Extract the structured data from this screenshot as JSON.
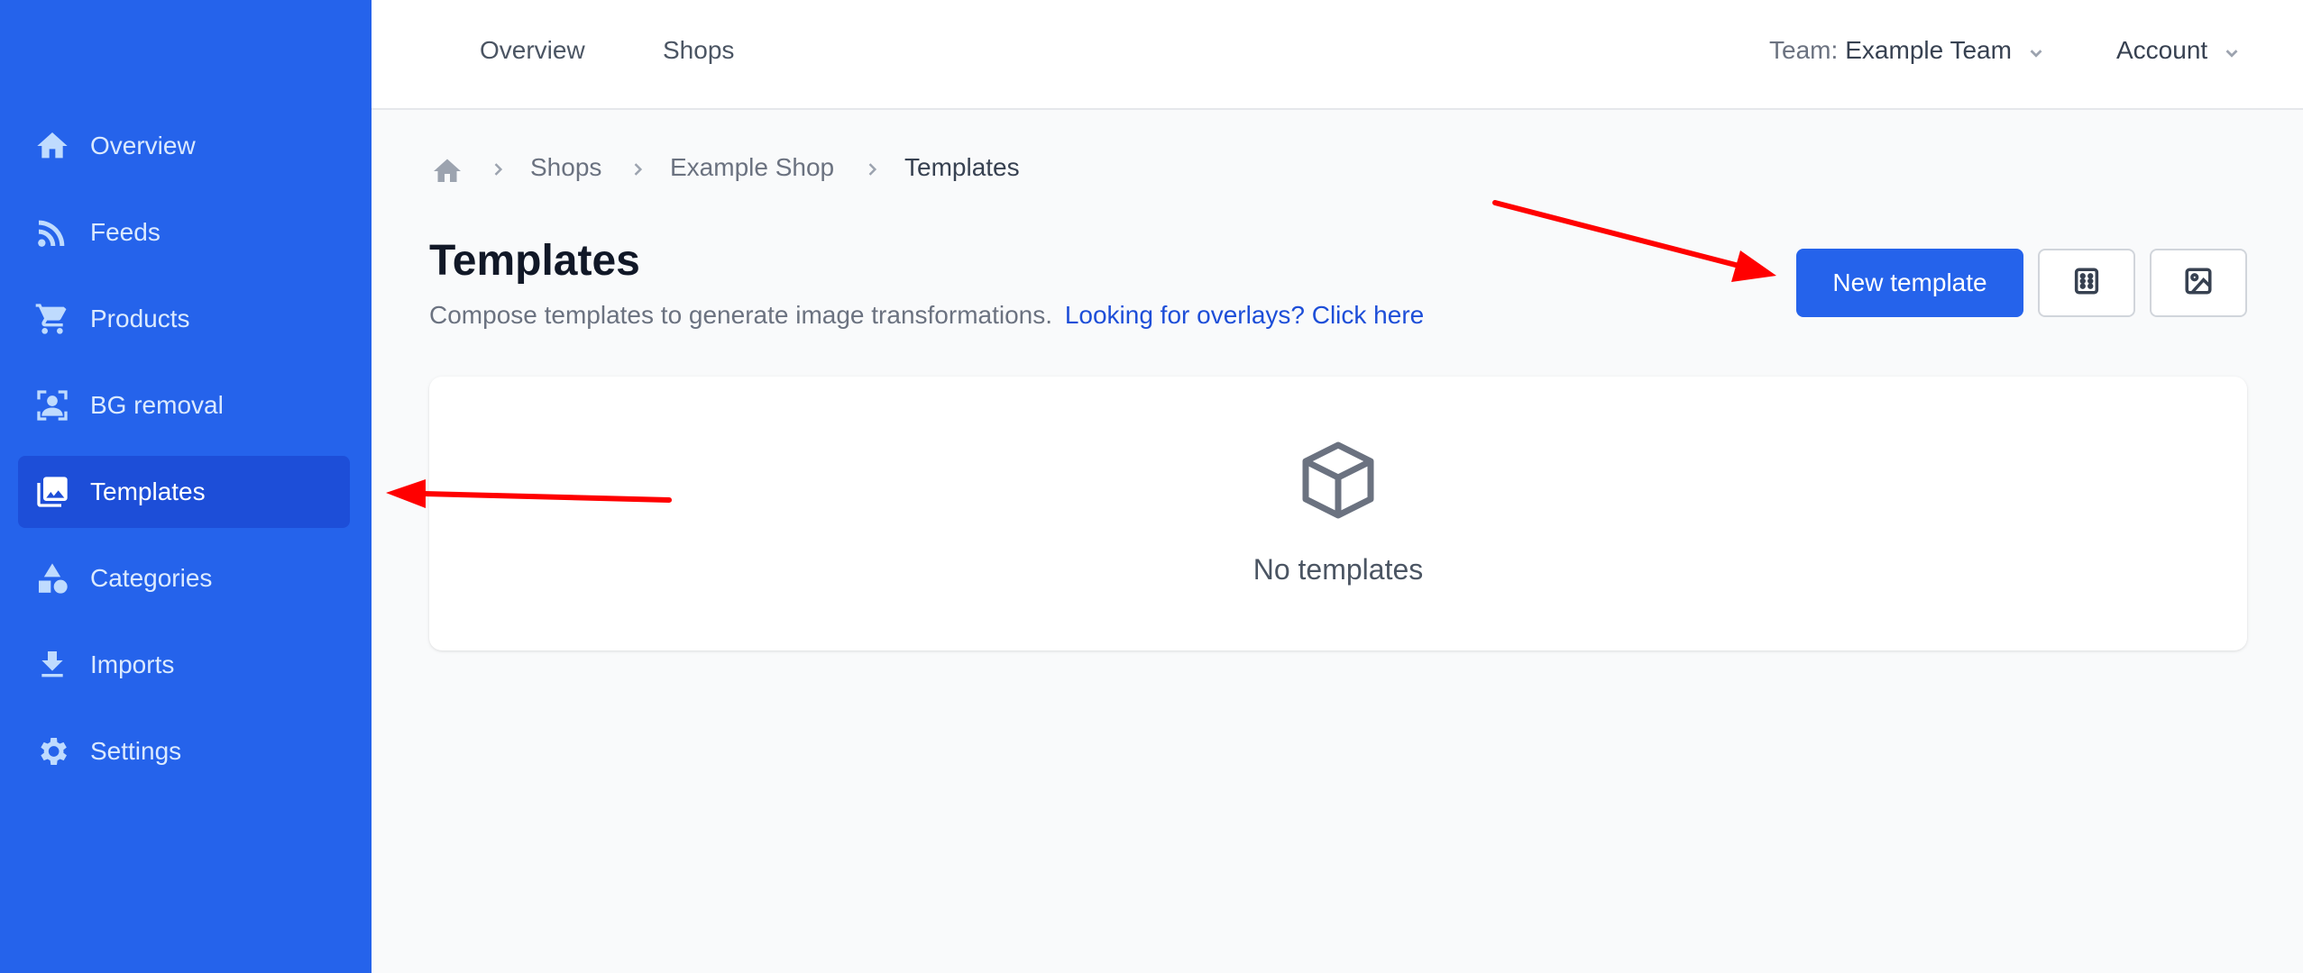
{
  "sidebar": {
    "items": [
      {
        "label": "Overview",
        "icon": "home-icon"
      },
      {
        "label": "Feeds",
        "icon": "rss-icon"
      },
      {
        "label": "Products",
        "icon": "cart-icon"
      },
      {
        "label": "BG removal",
        "icon": "bg-removal-icon"
      },
      {
        "label": "Templates",
        "icon": "images-icon",
        "active": true
      },
      {
        "label": "Categories",
        "icon": "shapes-icon"
      },
      {
        "label": "Imports",
        "icon": "download-icon"
      },
      {
        "label": "Settings",
        "icon": "gear-icon"
      }
    ],
    "bg_color": "#2563eb",
    "active_color": "#1d4ed8"
  },
  "topbar": {
    "links": [
      "Overview",
      "Shops"
    ],
    "team_prefix": "Team:",
    "team_name": "Example Team",
    "account_label": "Account"
  },
  "breadcrumb": {
    "items": [
      "Shops",
      "Example Shop",
      "Templates"
    ]
  },
  "header": {
    "title": "Templates",
    "subtitle": "Compose templates to generate image transformations.",
    "link_text": "Looking for overlays? Click here",
    "new_button": "New template",
    "icon_buttons": [
      "grid-icon",
      "image-icon"
    ]
  },
  "empty_state": {
    "icon": "cube-icon",
    "text": "No templates"
  },
  "colors": {
    "primary": "#2563eb",
    "link": "#1d4ed8",
    "annotation": "#ff0000"
  }
}
